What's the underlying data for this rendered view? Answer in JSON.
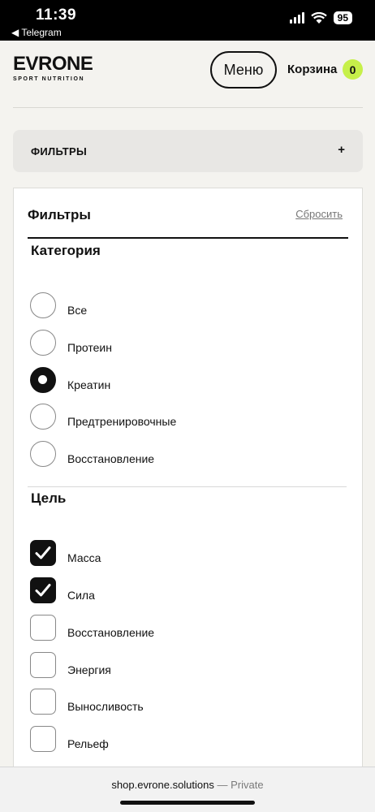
{
  "status_bar": {
    "time": "11:39",
    "back_label": "◀ Telegram",
    "battery": "95",
    "icons": [
      "signal-icon",
      "wifi-icon",
      "battery-icon"
    ]
  },
  "header": {
    "logo_main": "EVRONE",
    "logo_sub": "SPORT NUTRITION",
    "menu_label": "Меню",
    "cart_label": "Корзина",
    "cart_count": "0"
  },
  "accordion": {
    "label": "ФИЛЬТРЫ",
    "toggle": "+"
  },
  "filters": {
    "title": "Фильтры",
    "reset_label": "Сбросить",
    "category": {
      "title": "Категория",
      "options": [
        {
          "label": "Все",
          "checked": false
        },
        {
          "label": "Протеин",
          "checked": false
        },
        {
          "label": "Креатин",
          "checked": true
        },
        {
          "label": "Предтренировочные",
          "checked": false
        },
        {
          "label": "Восстановление",
          "checked": false
        }
      ]
    },
    "goal": {
      "title": "Цель",
      "options": [
        {
          "label": "Масса",
          "checked": true
        },
        {
          "label": "Сила",
          "checked": true
        },
        {
          "label": "Восстановление",
          "checked": false
        },
        {
          "label": "Энергия",
          "checked": false
        },
        {
          "label": "Выносливость",
          "checked": false
        },
        {
          "label": "Рельеф",
          "checked": false
        }
      ]
    }
  },
  "browser": {
    "host": "shop.evrone.solutions",
    "mode": " — Private"
  },
  "colors": {
    "accent_badge": "#c6f04a",
    "page_bg": "#f4f3ef",
    "panel_bg": "#ffffff"
  }
}
